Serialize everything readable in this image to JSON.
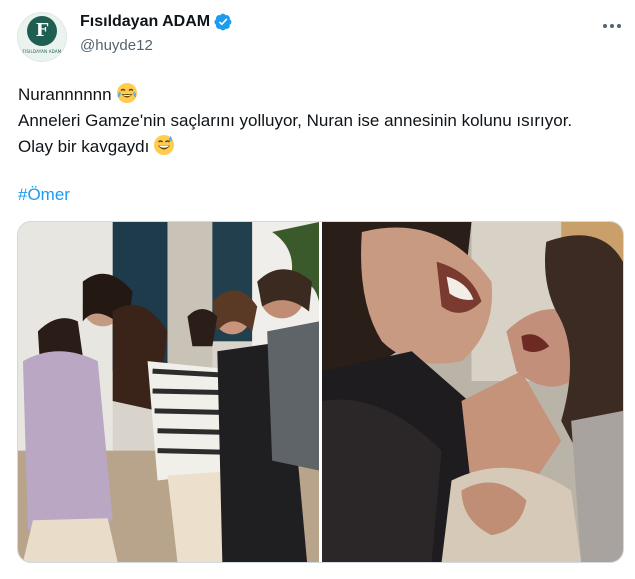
{
  "author": {
    "display_name": "Fısıldayan ADAM",
    "handle": "@huyde12",
    "avatar_letter": "F",
    "avatar_caption": "FISILDAYAN ADAM",
    "verified": true
  },
  "tweet": {
    "lines": [
      "Nurannnnnn",
      "Anneleri Gamze'nin saçlarını yolluyor, Nuran ise annesinin kolunu ısırıyor.",
      "Olay bir kavgaydı"
    ],
    "hashtag": "#Ömer",
    "emojis": [
      "face-with-tears-of-joy",
      "grinning-face-with-sweat"
    ]
  },
  "media": {
    "count": 2,
    "photos": [
      "fight-scene-wide",
      "fight-scene-closeup"
    ]
  },
  "icons": {
    "verified": "verified-badge-icon",
    "more": "more-options-icon"
  },
  "colors": {
    "link": "#1d9bf0",
    "verified": "#1d9bf0",
    "text": "#0f1419",
    "secondary": "#536471",
    "brand": "#1f5f52"
  }
}
